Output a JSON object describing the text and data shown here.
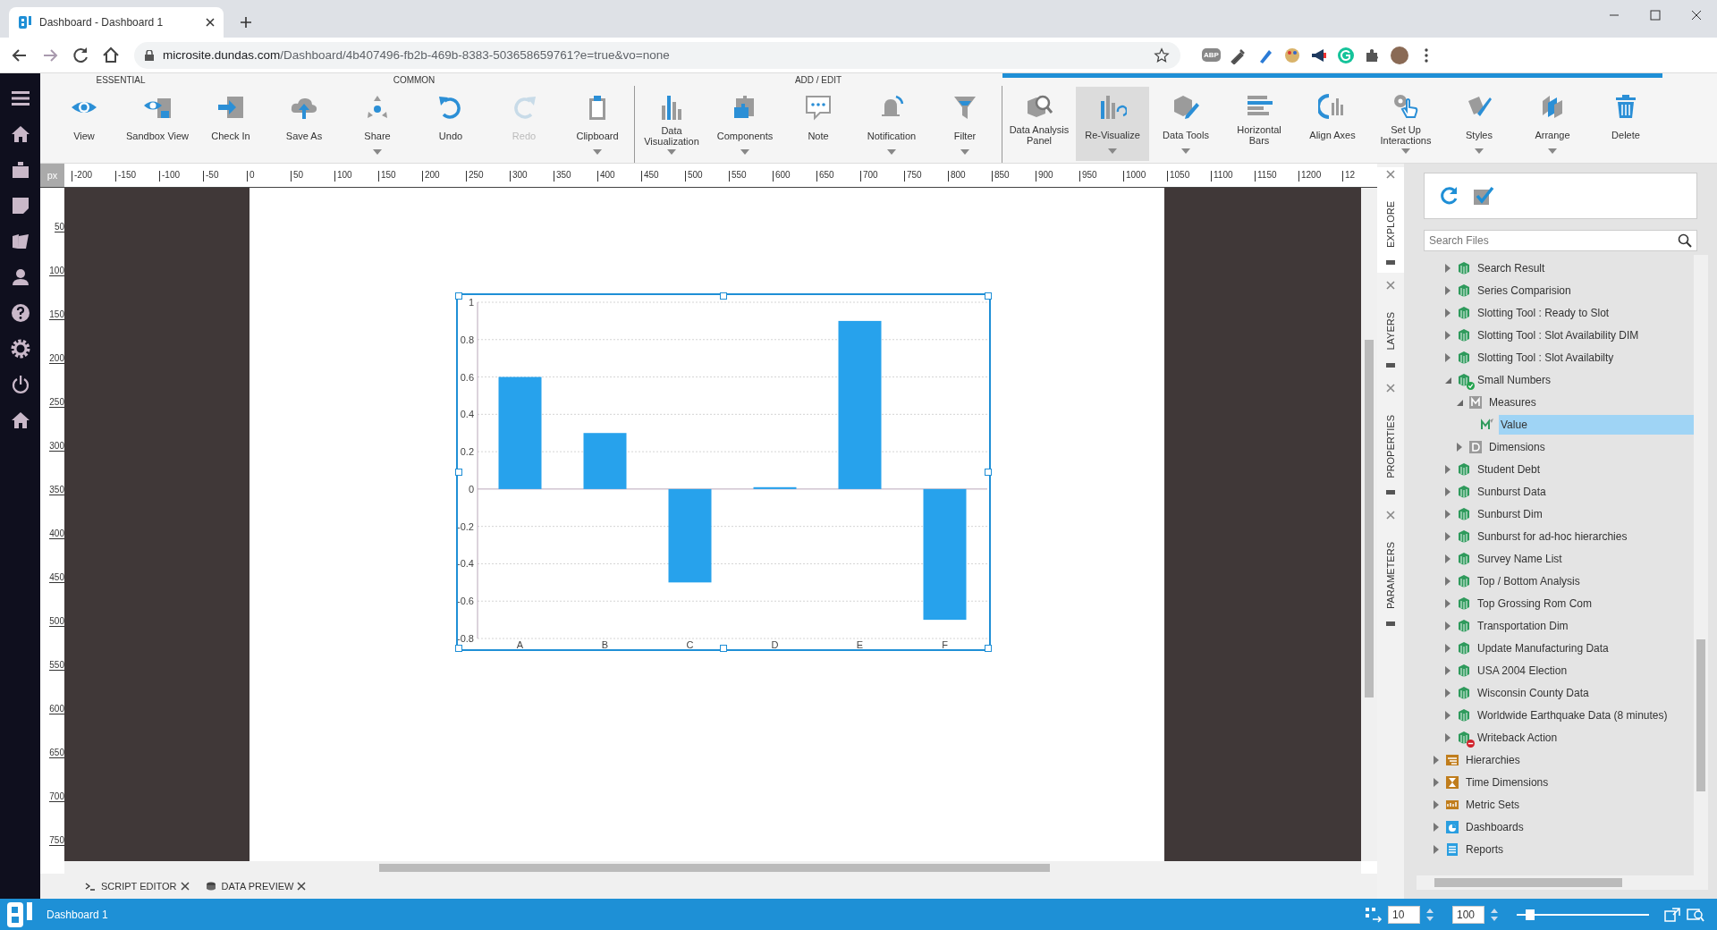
{
  "browser": {
    "tab_title": "Dashboard - Dashboard 1",
    "url_host": "microsite.dundas.com",
    "url_path": "/Dashboard/4b407496-fb2b-469b-8383-503658659761?e=true&vo=none",
    "extension_badge": "ABP"
  },
  "toolbar": {
    "groups": [
      {
        "label": "ESSENTIAL",
        "separated": false,
        "context": false,
        "buttons": [
          {
            "label": "View",
            "dropdown": false,
            "disabled": false,
            "highlighted": false
          },
          {
            "label": "Sandbox View",
            "dropdown": false,
            "disabled": false,
            "highlighted": false
          }
        ]
      },
      {
        "label": "COMMON",
        "separated": false,
        "context": false,
        "buttons": [
          {
            "label": "Check In",
            "dropdown": false,
            "disabled": false,
            "highlighted": false
          },
          {
            "label": "Save As",
            "dropdown": false,
            "disabled": false,
            "highlighted": false
          },
          {
            "label": "Share",
            "dropdown": true,
            "disabled": false,
            "highlighted": false
          },
          {
            "label": "Undo",
            "dropdown": false,
            "disabled": false,
            "highlighted": false
          },
          {
            "label": "Redo",
            "dropdown": false,
            "disabled": true,
            "highlighted": false
          },
          {
            "label": "Clipboard",
            "dropdown": true,
            "disabled": false,
            "highlighted": false
          }
        ]
      },
      {
        "label": "ADD / EDIT",
        "separated": true,
        "context": false,
        "buttons": [
          {
            "label": "Data\nVisualization",
            "dropdown": true,
            "disabled": false,
            "highlighted": false
          },
          {
            "label": "Components",
            "dropdown": true,
            "disabled": false,
            "highlighted": false
          },
          {
            "label": "Note",
            "dropdown": false,
            "disabled": false,
            "highlighted": false
          },
          {
            "label": "Notification",
            "dropdown": true,
            "disabled": false,
            "highlighted": false
          },
          {
            "label": "Filter",
            "dropdown": true,
            "disabled": false,
            "highlighted": false
          }
        ]
      },
      {
        "separated": true,
        "context": true,
        "buttons": [
          {
            "label": "Data Analysis\nPanel",
            "dropdown": false,
            "disabled": false,
            "highlighted": false
          },
          {
            "label": "Re-Visualize",
            "dropdown": true,
            "disabled": false,
            "highlighted": true
          },
          {
            "label": "Data Tools",
            "dropdown": true,
            "disabled": false,
            "highlighted": false
          },
          {
            "label": "Horizontal\nBars",
            "dropdown": false,
            "disabled": false,
            "highlighted": false
          },
          {
            "label": "Align Axes",
            "dropdown": false,
            "disabled": false,
            "highlighted": false
          },
          {
            "label": "Set Up\nInteractions",
            "dropdown": true,
            "disabled": false,
            "highlighted": false
          },
          {
            "label": "Styles",
            "dropdown": true,
            "disabled": false,
            "highlighted": false
          },
          {
            "label": "Arrange",
            "dropdown": true,
            "disabled": false,
            "highlighted": false
          },
          {
            "label": "Delete",
            "dropdown": false,
            "disabled": false,
            "highlighted": false
          }
        ]
      }
    ]
  },
  "ruler": {
    "unit": "px",
    "x_labels": [
      "-200",
      "-150",
      "-100",
      "-50",
      "0",
      "50",
      "100",
      "150",
      "200",
      "250",
      "300",
      "350",
      "400",
      "450",
      "500",
      "550",
      "600",
      "650",
      "700",
      "750",
      "800",
      "850",
      "900",
      "950",
      "1000",
      "1050",
      "1100",
      "1150",
      "1200",
      "12"
    ],
    "y_labels": [
      "50",
      "100",
      "150",
      "200",
      "250",
      "300",
      "350",
      "400",
      "450",
      "500",
      "550",
      "600",
      "650",
      "700",
      "750"
    ]
  },
  "chart": {
    "chart_data": {
      "type": "bar",
      "categories": [
        "A",
        "B",
        "C",
        "D",
        "E",
        "F"
      ],
      "series": [
        {
          "color": "#27a2ec",
          "values": [
            0.6,
            0.3,
            -0.5,
            0.01,
            0.9,
            -0.7
          ]
        }
      ],
      "ylim": [
        -0.8,
        1
      ],
      "grid": true,
      "yticks": [
        1,
        0.8,
        0.6,
        0.4,
        0.2,
        0,
        -0.2,
        -0.4,
        -0.6,
        -0.8
      ]
    }
  },
  "side_tabs": [
    {
      "label": "EXPLORE",
      "selected": true
    },
    {
      "label": "LAYERS",
      "selected": false
    },
    {
      "label": "PROPERTIES",
      "selected": false
    },
    {
      "label": "PARAMETERS",
      "selected": false
    }
  ],
  "explore": {
    "search": {
      "placeholder": "Search Files"
    },
    "tree": [
      {
        "children": [
          {
            "label": "Search Result",
            "kind": "cube",
            "expanded": false,
            "selected": false
          },
          {
            "label": "Series Comparision",
            "kind": "cube",
            "expanded": false,
            "selected": false
          },
          {
            "label": "Slotting Tool : Ready to Slot",
            "kind": "cube",
            "expanded": false,
            "selected": false
          },
          {
            "label": "Slotting Tool : Slot Availability DIM",
            "kind": "cube",
            "expanded": false,
            "selected": false
          },
          {
            "label": "Slotting Tool : Slot Availabilty",
            "kind": "cube",
            "expanded": false,
            "selected": false
          },
          {
            "label": "Small Numbers",
            "kind": "cube",
            "validated": true,
            "expanded": true,
            "selected": false,
            "children": [
              {
                "label": "Measures",
                "kind": "measures",
                "expanded": true,
                "selected": false,
                "children": [
                  {
                    "label": "Value",
                    "kind": "measure",
                    "selected": true
                  }
                ]
              },
              {
                "label": "Dimensions",
                "kind": "dimensions",
                "expanded": false,
                "selected": false
              }
            ]
          },
          {
            "label": "Student Debt",
            "kind": "cube",
            "expanded": false,
            "selected": false
          },
          {
            "label": "Sunburst Data",
            "kind": "cube",
            "expanded": false,
            "selected": false
          },
          {
            "label": "Sunburst Dim",
            "kind": "cube",
            "expanded": false,
            "selected": false
          },
          {
            "label": "Sunburst for ad-hoc hierarchies",
            "kind": "cube",
            "expanded": false,
            "selected": false
          },
          {
            "label": "Survey Name List",
            "kind": "cube",
            "expanded": false,
            "selected": false
          },
          {
            "label": "Top / Bottom Analysis",
            "kind": "cube",
            "expanded": false,
            "selected": false
          },
          {
            "label": "Top Grossing Rom Com",
            "kind": "cube",
            "expanded": false,
            "selected": false
          },
          {
            "label": "Transportation Dim",
            "kind": "cube",
            "expanded": false,
            "selected": false
          },
          {
            "label": "Update Manufacturing Data",
            "kind": "cube",
            "expanded": false,
            "selected": false
          },
          {
            "label": "USA 2004 Election",
            "kind": "cube",
            "expanded": false,
            "selected": false
          },
          {
            "label": "Wisconsin County Data",
            "kind": "cube",
            "expanded": false,
            "selected": false
          },
          {
            "label": "Worldwide Earthquake Data (8 minutes)",
            "kind": "cube",
            "expanded": false,
            "selected": false
          },
          {
            "label": "Writeback Action",
            "kind": "cube",
            "errored": true,
            "expanded": false,
            "selected": false
          }
        ]
      },
      {
        "label": "Hierarchies",
        "kind": "hierarchies",
        "expanded": false,
        "selected": false
      },
      {
        "label": "Time Dimensions",
        "kind": "time",
        "expanded": false,
        "selected": false
      },
      {
        "label": "Metric Sets",
        "kind": "metrics",
        "expanded": false,
        "selected": false
      },
      {
        "label": "Dashboards",
        "kind": "dashboards",
        "expanded": false,
        "selected": false
      },
      {
        "label": "Reports",
        "kind": "reports",
        "expanded": false,
        "selected": false
      }
    ]
  },
  "bottom_tabs": [
    {
      "label": "SCRIPT EDITOR",
      "kind": "script"
    },
    {
      "label": "DATA PREVIEW",
      "kind": "preview"
    }
  ],
  "status_bar": {
    "document": "Dashboard 1",
    "grid_size": "10",
    "zoom": "100",
    "zoom_slider": {
      "level": 0.1
    }
  }
}
